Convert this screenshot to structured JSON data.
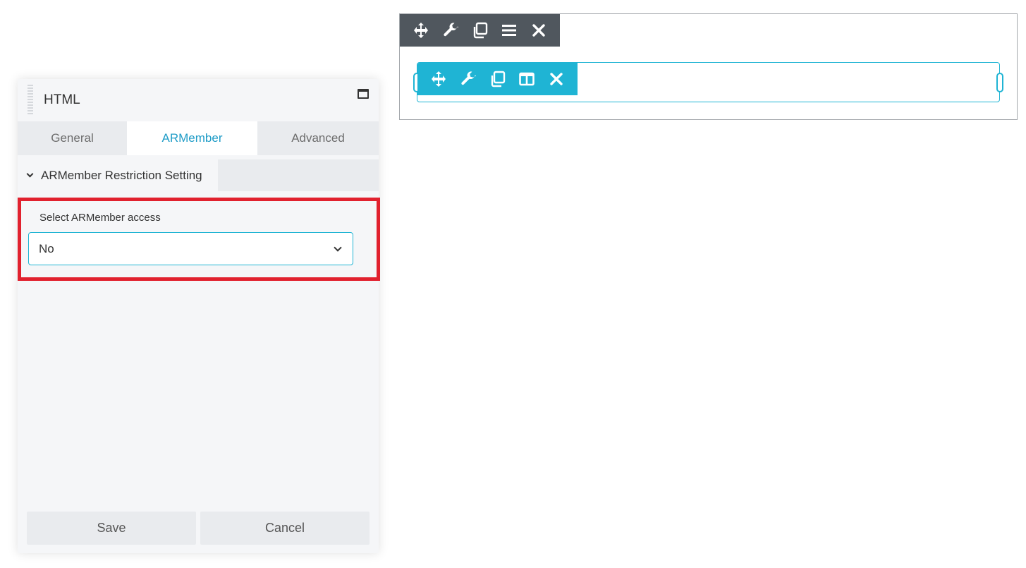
{
  "panel": {
    "title": "HTML",
    "tabs": [
      {
        "label": "General",
        "active": false
      },
      {
        "label": "ARMember",
        "active": true
      },
      {
        "label": "Advanced",
        "active": false
      }
    ],
    "section": {
      "label": "ARMember Restriction Setting",
      "expanded": true
    },
    "field": {
      "label": "Select ARMember access",
      "value": "No"
    },
    "buttons": {
      "save": "Save",
      "cancel": "Cancel"
    }
  },
  "canvas": {
    "row_toolbar_icons": [
      "move-icon",
      "wrench-icon",
      "duplicate-icon",
      "menu-icon",
      "close-icon"
    ],
    "column_toolbar_icons": [
      "move-icon",
      "wrench-icon",
      "duplicate-icon",
      "columns-icon",
      "close-icon"
    ]
  },
  "colors": {
    "accent": "#1fb4d4",
    "tab_active_text": "#1f9cc7",
    "row_toolbar": "#50575e",
    "highlight": "#e1212e",
    "panel_bg": "#f5f6f8"
  }
}
